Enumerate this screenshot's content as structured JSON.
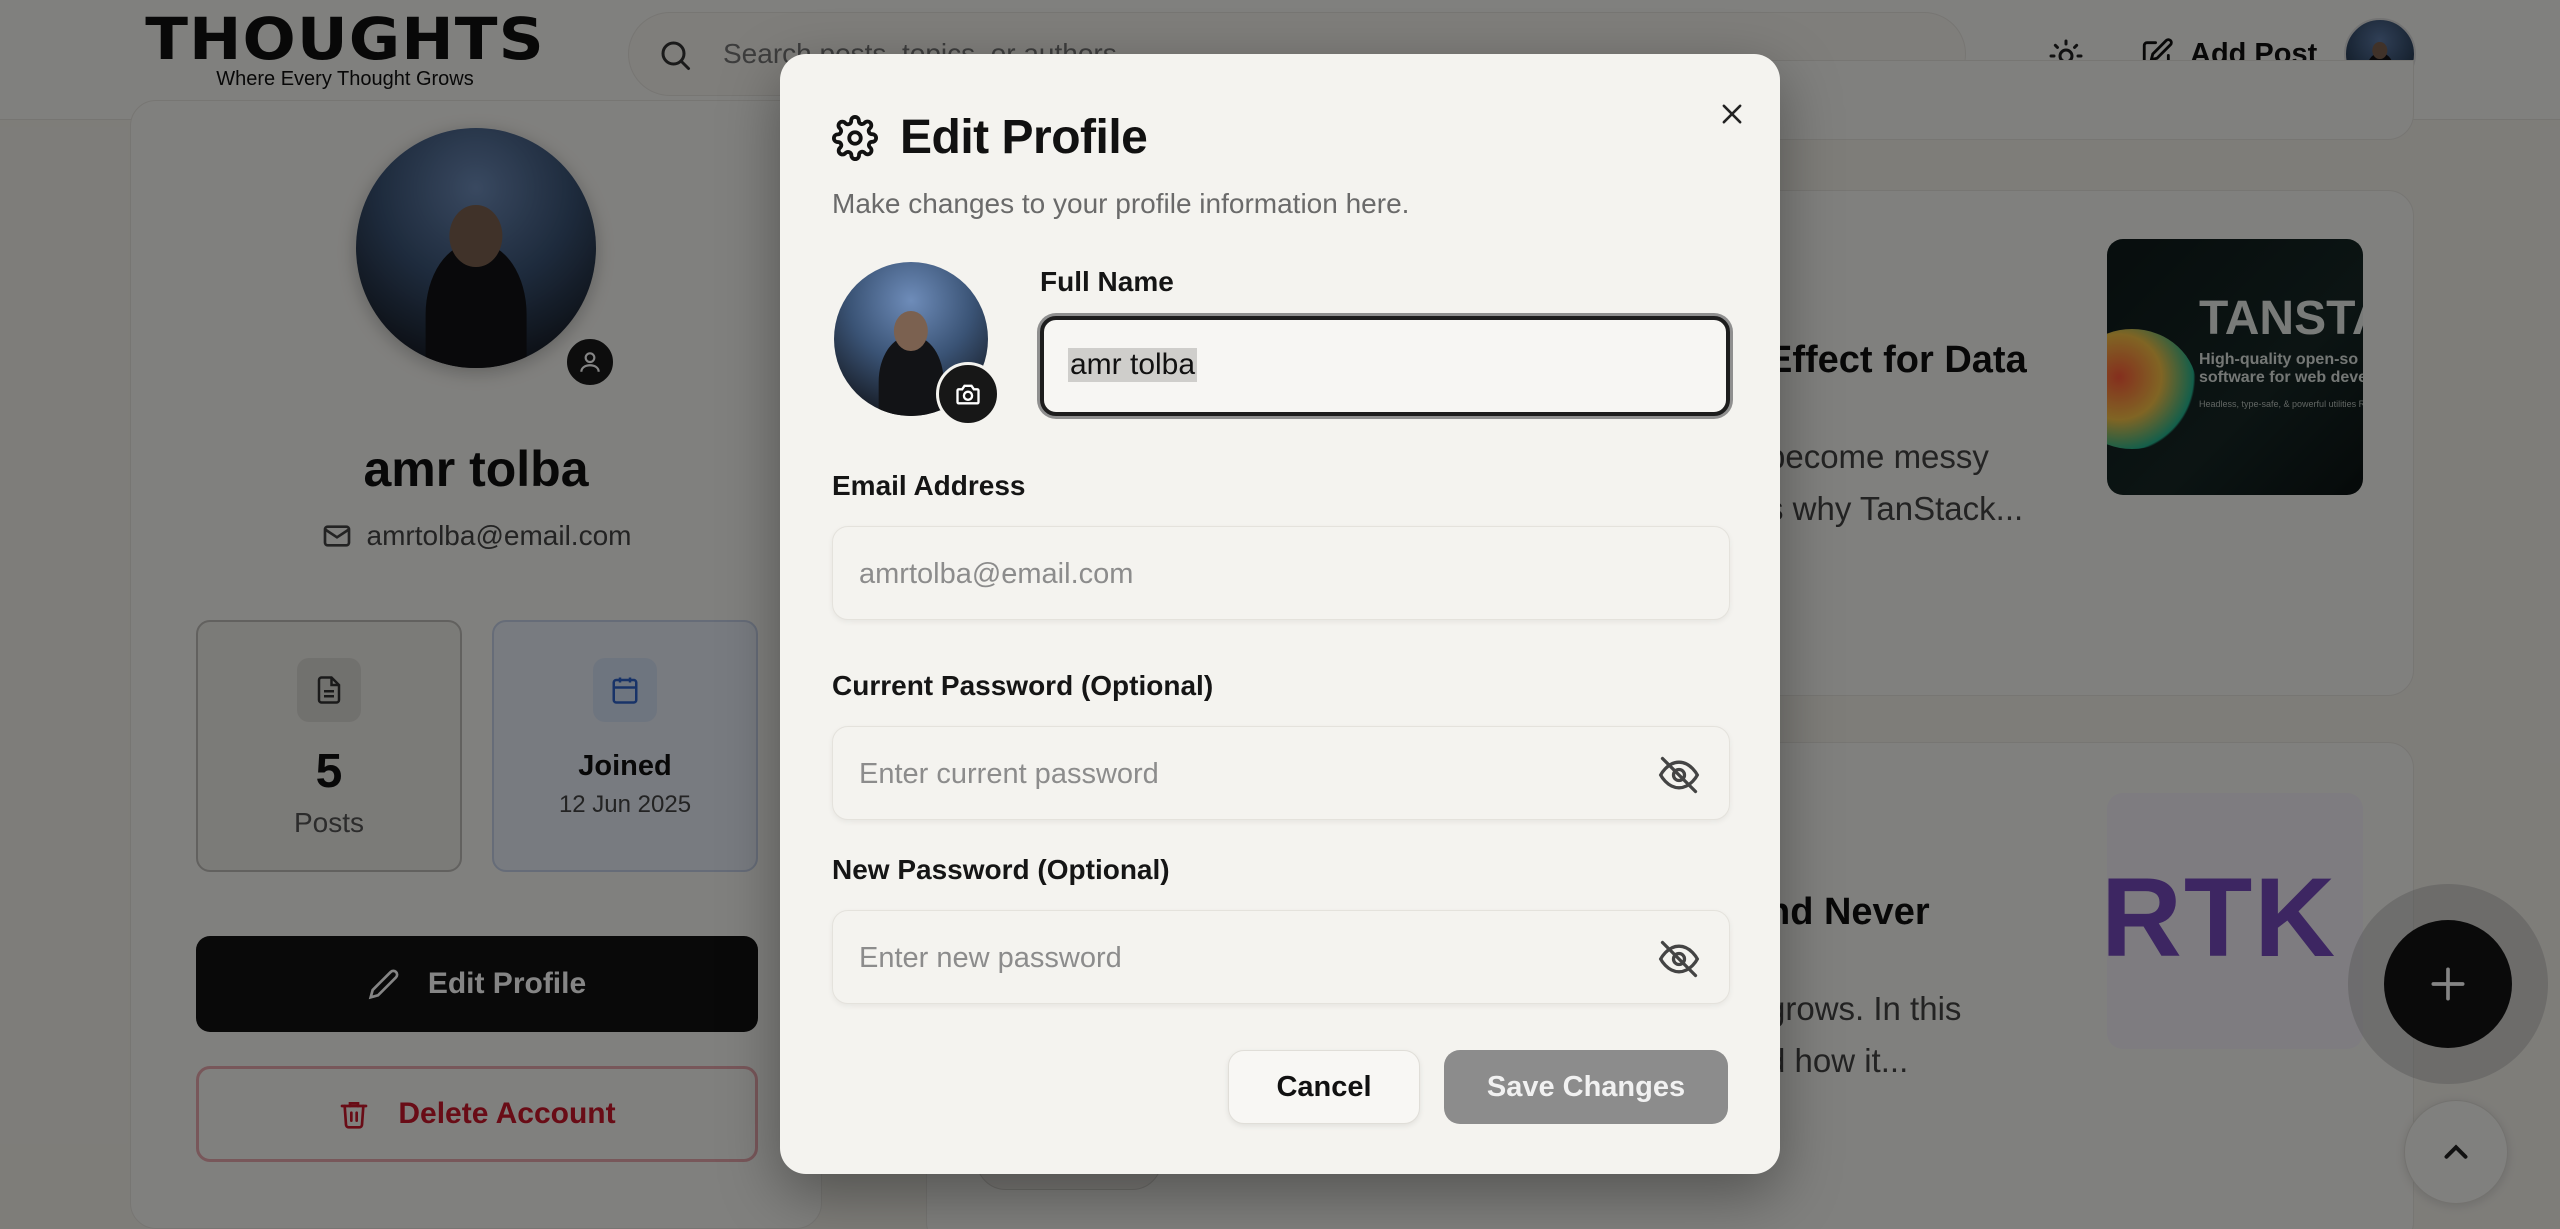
{
  "header": {
    "logo_title": "THOUGHTS",
    "logo_tagline": "Where Every Thought Grows",
    "search_placeholder": "Search posts, topics, or authors...",
    "add_post_label": "Add Post"
  },
  "profile": {
    "name": "amr tolba",
    "email": "amrtolba@email.com",
    "stats": {
      "posts_count": "5",
      "posts_label": "Posts",
      "joined_label": "Joined",
      "joined_date": "12 Jun 2025"
    },
    "edit_button": "Edit Profile",
    "delete_button": "Delete Account"
  },
  "posts": [
    {
      "title_visible": "Effect for Data",
      "excerpt_lines": [
        "become messy",
        "s why TanStack..."
      ],
      "thumbnail": {
        "word": "TANSTA",
        "tagline": "High-quality open-so",
        "tagline2": "software for web deve",
        "fineprint": "Headless, type-safe, & powerful utilities Routing, State Management, Data Visual Datagrids/Tables, and more."
      }
    },
    {
      "title_visible": "nd Never",
      "excerpt_lines": [
        "grows. In this",
        "d how it..."
      ],
      "thumbnail": {
        "word": "RTK Q"
      }
    }
  ],
  "modal": {
    "title": "Edit Profile",
    "description": "Make changes to your profile information here.",
    "full_name_label": "Full Name",
    "full_name_value": "amr tolba",
    "email_label": "Email Address",
    "email_placeholder": "amrtolba@email.com",
    "current_password_label": "Current Password (Optional)",
    "current_password_placeholder": "Enter current password",
    "new_password_label": "New Password (Optional)",
    "new_password_placeholder": "Enter new password",
    "cancel_label": "Cancel",
    "save_label": "Save Changes"
  },
  "colors": {
    "accent_dark": "#131313",
    "danger": "#c9182b",
    "joined_card_bg": "#e6ecf5",
    "save_disabled": "#8c8c8c"
  }
}
